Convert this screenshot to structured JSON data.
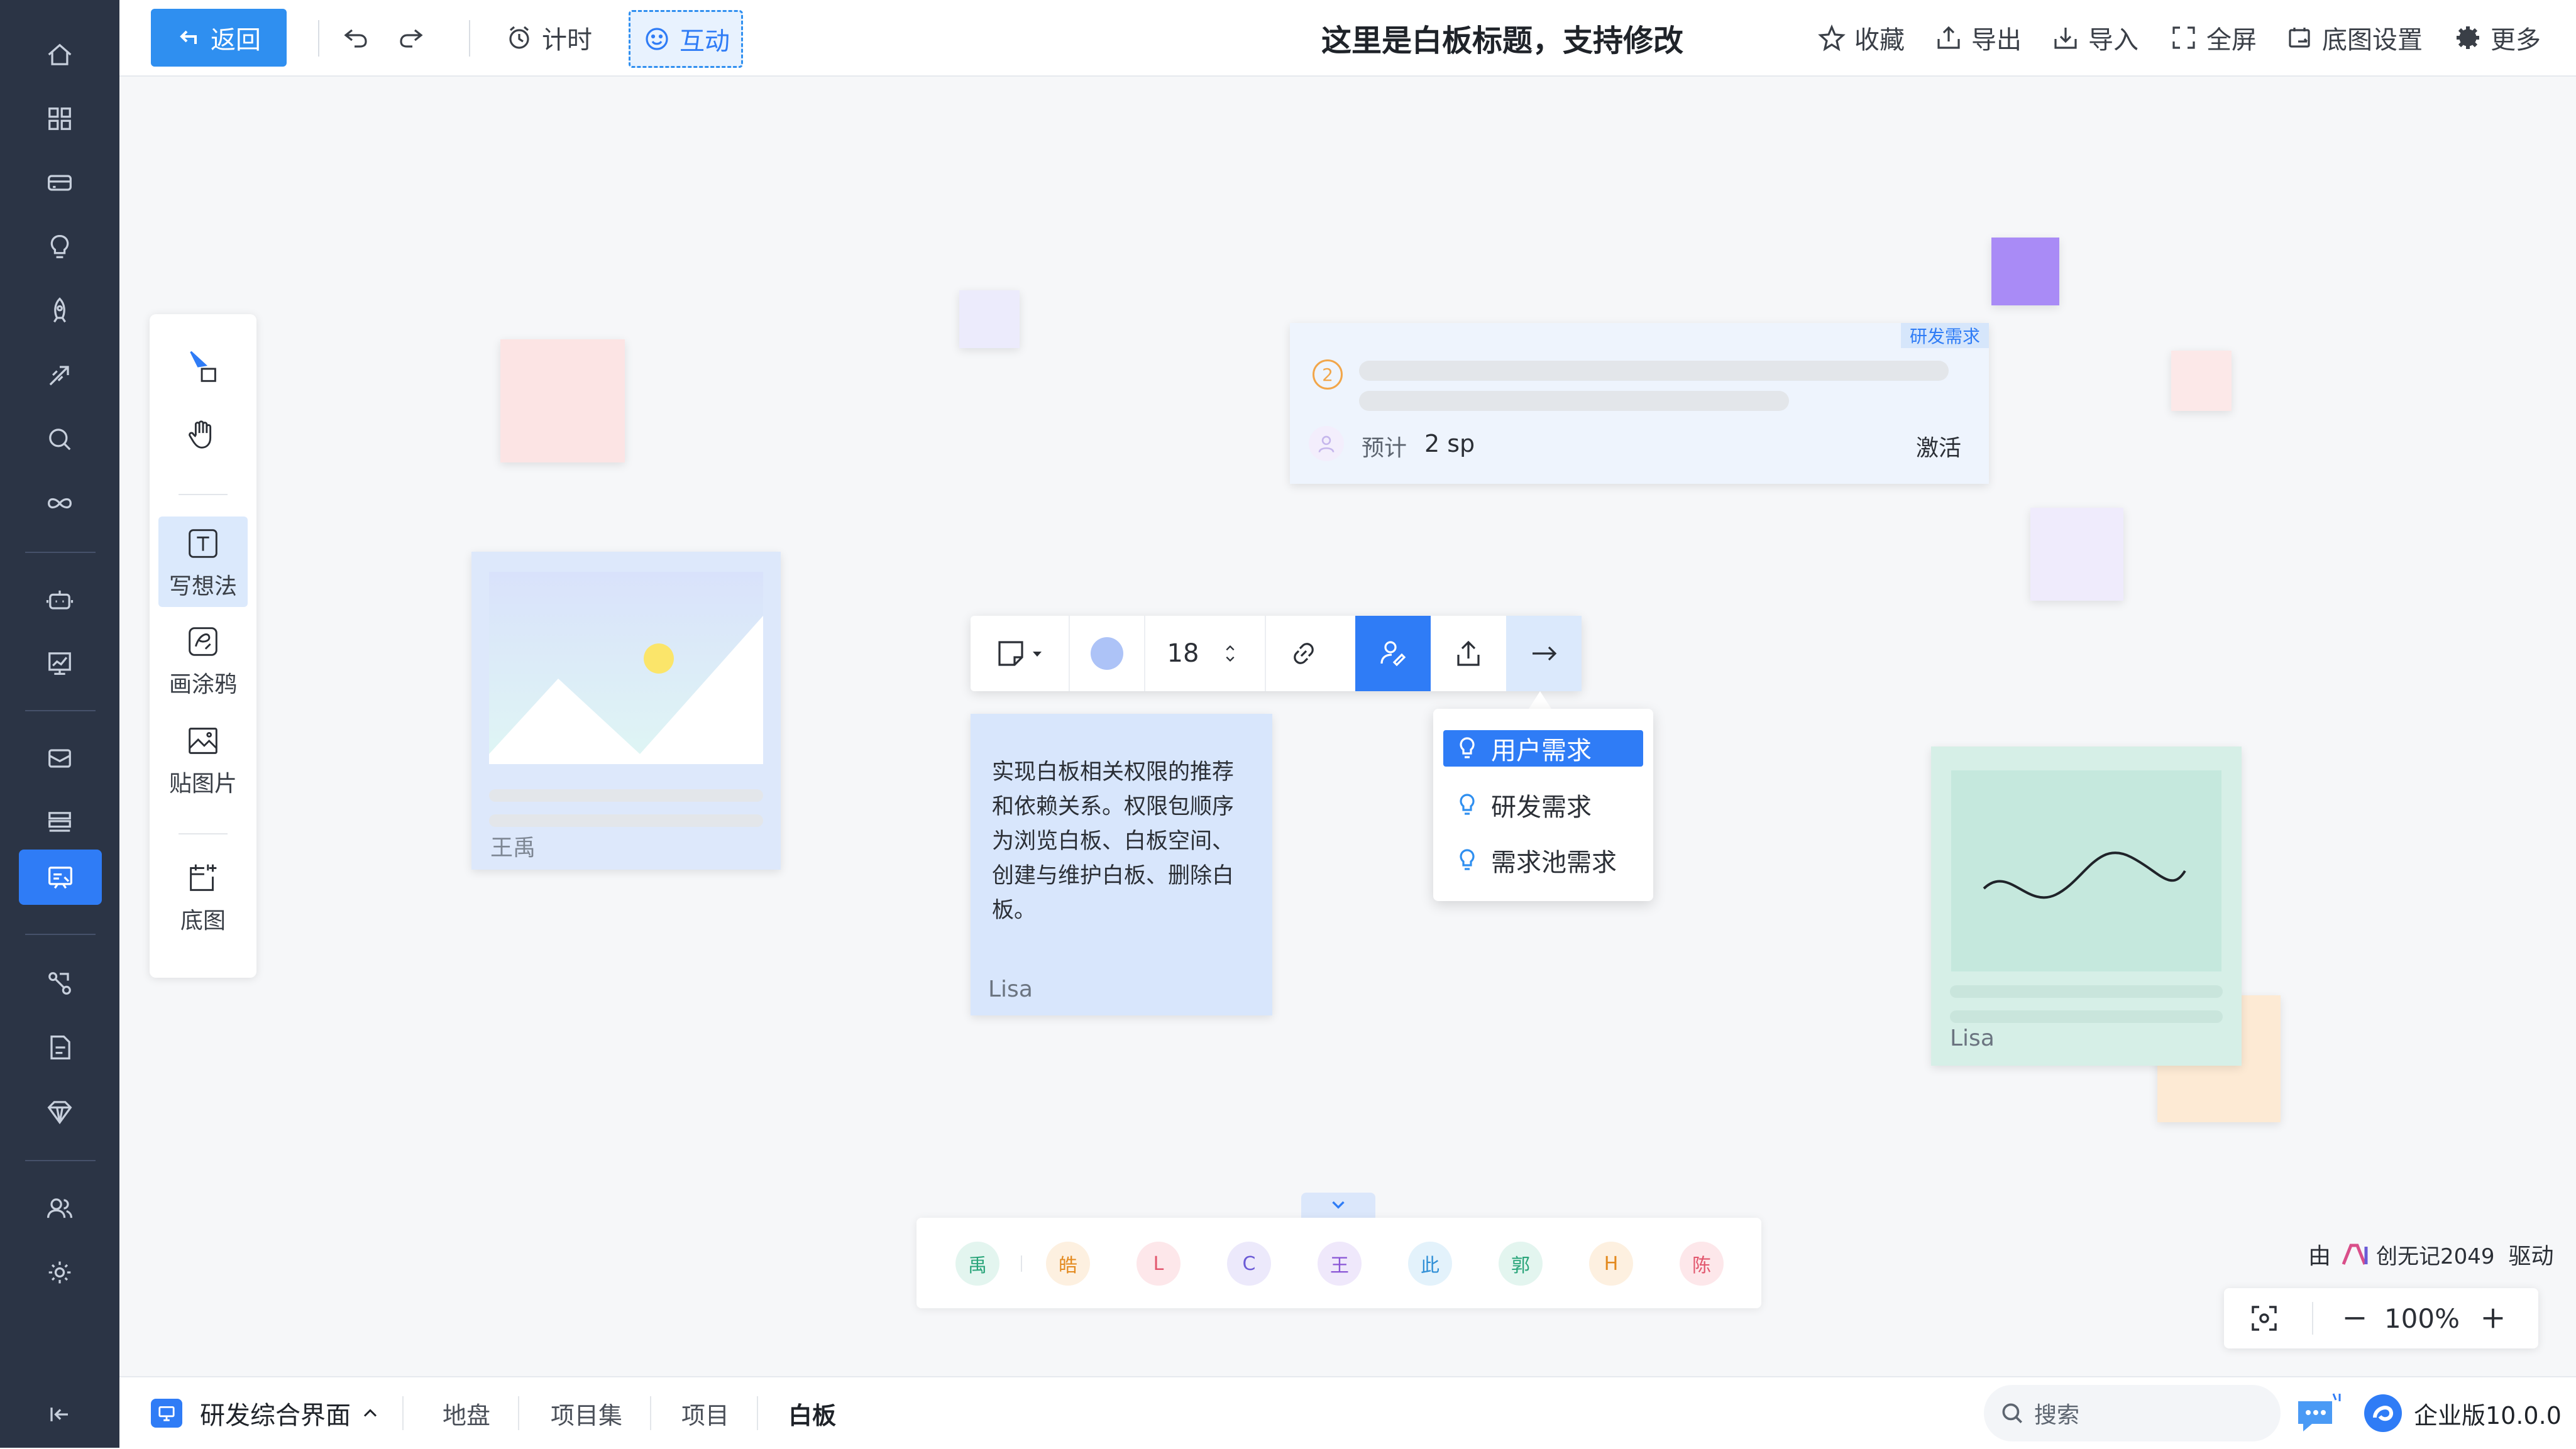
{
  "topbar": {
    "back_label": "返回",
    "timer_label": "计时",
    "interact_label": "互动",
    "title": "这里是白板标题，支持修改",
    "actions": [
      "收藏",
      "导出",
      "导入",
      "全屏",
      "底图设置",
      "更多"
    ]
  },
  "tools": [
    "写想法",
    "画涂鸦",
    "贴图片",
    "底图"
  ],
  "image_card": {
    "author": "王禹"
  },
  "req_card": {
    "tag": "研发需求",
    "priority": "2",
    "estimate_label": "预计",
    "estimate_value": "2 sp",
    "status": "激活"
  },
  "note_card": {
    "text": "实现白板相关权限的推荐和依赖关系。权限包顺序为浏览白板、白板空间、创建与维护白板、删除白板。",
    "author": "Lisa"
  },
  "doodle_card": {
    "author": "Lisa"
  },
  "float_toolbar": {
    "font_size": "18"
  },
  "req_menu": {
    "items": [
      "用户需求",
      "研发需求",
      "需求池需求"
    ]
  },
  "collaborators": [
    {
      "initial": "禹",
      "bg": "#e3f5ef",
      "fg": "#2aa57a"
    },
    {
      "initial": "皓",
      "bg": "#fdf0e0",
      "fg": "#e38a1f"
    },
    {
      "initial": "L",
      "bg": "#fde7ea",
      "fg": "#e2566d"
    },
    {
      "initial": "C",
      "bg": "#ece9fb",
      "fg": "#6c5bd6"
    },
    {
      "initial": "王",
      "bg": "#efe8fb",
      "fg": "#8a56d6"
    },
    {
      "initial": "此",
      "bg": "#e3f2fb",
      "fg": "#2f8fd6"
    },
    {
      "initial": "郭",
      "bg": "#e3f5ef",
      "fg": "#2aa57a"
    },
    {
      "initial": "H",
      "bg": "#fdf0e0",
      "fg": "#e38a1f"
    },
    {
      "initial": "陈",
      "bg": "#fde7ea",
      "fg": "#e2566d"
    }
  ],
  "powered": {
    "prefix": "由",
    "brand": "创无记2049",
    "suffix": "驱动"
  },
  "zoom": {
    "level": "100%"
  },
  "bottombar": {
    "workspace": "研发综合界面",
    "tabs": [
      "地盘",
      "项目集",
      "项目",
      "白板"
    ],
    "active_tab": "白板",
    "search_placeholder": "搜索",
    "edition": "企业版10.0.0"
  },
  "colors": {
    "accent": "#2f7cf6",
    "nav_bg": "#2b3445"
  }
}
